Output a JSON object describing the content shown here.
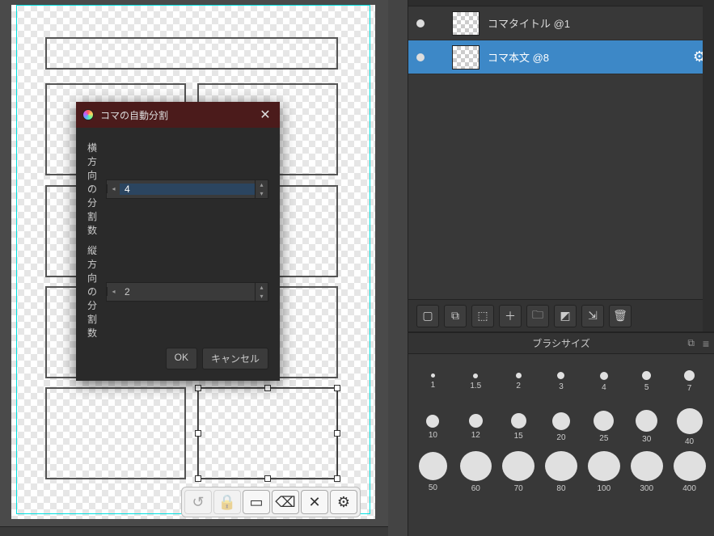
{
  "dialog": {
    "title": "コマの自動分割",
    "rows_label": "横方向の分割数",
    "cols_label": "縦方向の分割数",
    "rows_value": "4",
    "cols_value": "2",
    "ok": "OK",
    "cancel": "キャンセル"
  },
  "layers": {
    "items": [
      {
        "name": "コマタイトル @1",
        "selected": false
      },
      {
        "name": "コマ本文 @8",
        "selected": true
      }
    ]
  },
  "layer_toolbar": {
    "icons": [
      "new",
      "dup",
      "newf",
      "addfx",
      "folder",
      "mask",
      "merge",
      "trash"
    ]
  },
  "brush": {
    "title": "ブラシサイズ",
    "sizes": [
      1,
      1.5,
      2,
      3,
      4,
      5,
      7,
      10,
      12,
      15,
      20,
      25,
      30,
      40,
      50,
      60,
      70,
      80,
      100,
      300,
      400
    ]
  },
  "canvas": {
    "panels_grid": {
      "cols": 2,
      "rows": 4
    }
  }
}
